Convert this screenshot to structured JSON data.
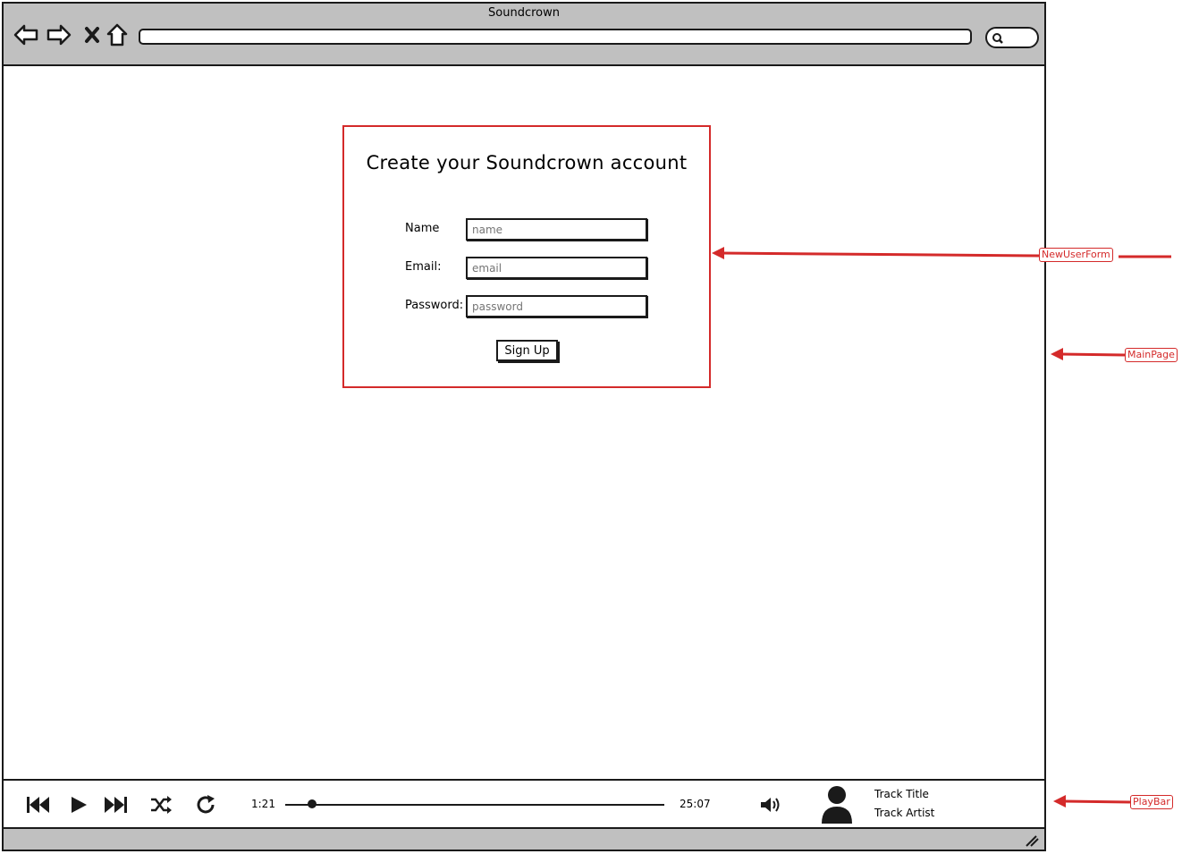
{
  "browser": {
    "title": "Soundcrown",
    "url": ""
  },
  "form": {
    "title": "Create your Soundcrown account",
    "fields": [
      {
        "label": "Name",
        "placeholder": "name"
      },
      {
        "label": "Email:",
        "placeholder": "email"
      },
      {
        "label": "Password:",
        "placeholder": "password"
      }
    ],
    "submit_label": "Sign Up"
  },
  "playbar": {
    "current_time": "1:21",
    "total_time": "25:07",
    "progress": 0.065,
    "track_title": "Track Title",
    "track_artist": "Track Artist"
  },
  "annotations": {
    "new_user_form": "NewUserForm",
    "main_page": "MainPage",
    "play_bar": "PlayBar"
  },
  "colors": {
    "annotation": "#d42a2a",
    "chrome": "#c0c0c0"
  }
}
